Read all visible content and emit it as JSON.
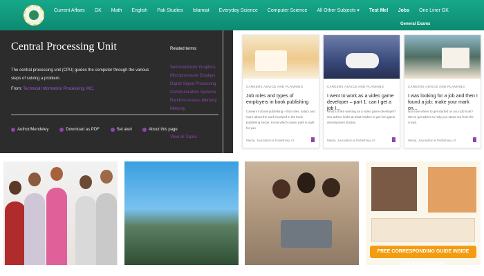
{
  "nav": {
    "items": [
      "Current Affairs",
      "GK",
      "Math",
      "English",
      "Pak Studies",
      "Islamiat",
      "Everyday Science",
      "Computer Science",
      "All Other Subjects ▾",
      "Test Me!",
      "Jobs",
      "One Liner GK"
    ],
    "sub_item": "General Exams"
  },
  "article": {
    "title": "Central Processing Unit",
    "description": "The central processing unit (CPU) guides the computer through the various steps of solving a problem.",
    "from_prefix": "From:",
    "from_link": "Technical Information Processing, INC.",
    "actions": [
      "Author/Mendeley",
      "Download as PDF",
      "Set alert"
    ],
    "about": "About this page",
    "related_title": "Related terms:",
    "related_terms": [
      "Semiconductor Graphics",
      "Microprocessor Displays",
      "Digital Signal Processing",
      "Communication Systems",
      "Random-Access Memory",
      "Memory"
    ],
    "see_all": "View all Topics"
  },
  "cards": [
    {
      "category": "CAREERS ADVICE AND PLANNING",
      "title": "Job roles and types of employers in book publishing",
      "desc": "Careers in book publishing – find roles, salary and more about the work involved in the book publishing sector. Know which career path is right for you",
      "footer": "Media, Journalism & Publishing +3"
    },
    {
      "category": "CAREERS ADVICE AND PLANNING",
      "title": "I went to work as a video game developer – part 1: can I get a job I...",
      "desc": "What's it like working as a video game developer? Our advice looks at what it takes to get into game development studios.",
      "footer": "Media, Journalism & Publishing +3"
    },
    {
      "category": "CAREERS ADVICE AND PLANNING",
      "title": "I was looking for a job and then I found a job: make your mark on...",
      "desc": "Not sure where to get started on your job hunt? We've got advice to help you stand out from the crowd.",
      "footer": "Media, Journalism & Publishing +3"
    }
  ],
  "tiles": {
    "banner": "FREE CORRESPONDING GUIDE INSIDE EACH CALENDAR!"
  }
}
